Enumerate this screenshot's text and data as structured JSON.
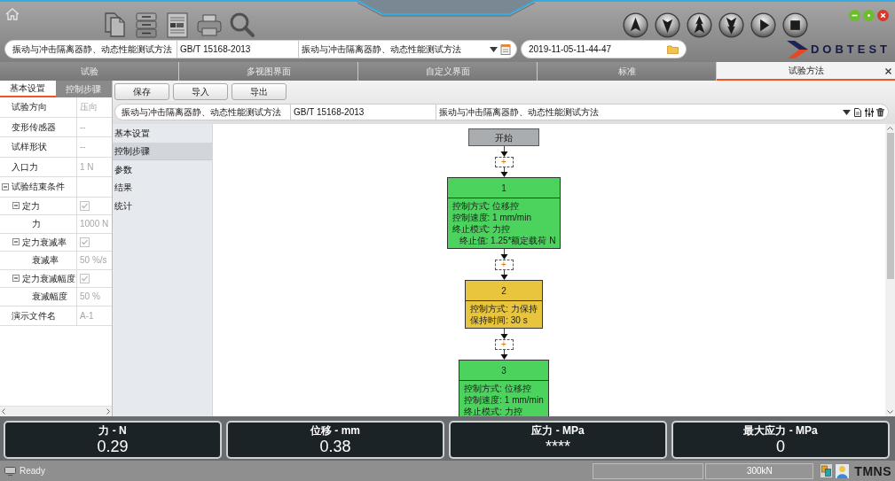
{
  "header": {
    "method_field": {
      "name": "振动与冲击隔离器静、动态性能测试方法",
      "standard": "GB/T 15168-2013",
      "title": "振动与冲击隔离器静、动态性能测试方法"
    },
    "date_field": {
      "value": "2019-11-05-11-44-47"
    },
    "logo": {
      "text": "DOBTEST"
    }
  },
  "tabs": [
    {
      "label": "试验",
      "selected": false
    },
    {
      "label": "多视图界面",
      "selected": false
    },
    {
      "label": "自定义界面",
      "selected": false
    },
    {
      "label": "标准",
      "selected": false
    },
    {
      "label": "试验方法",
      "selected": true
    }
  ],
  "left_panel": {
    "tabs": [
      {
        "label": "基本设置",
        "selected": true
      },
      {
        "label": "控制步骤",
        "selected": false
      }
    ],
    "properties": [
      {
        "kind": "text",
        "label": "试验方向",
        "value": "压向"
      },
      {
        "kind": "text",
        "label": "变形传感器",
        "value": "--"
      },
      {
        "kind": "text",
        "label": "试样形状",
        "value": "--"
      },
      {
        "kind": "text",
        "label": "入口力",
        "value": "1 N"
      },
      {
        "kind": "group",
        "label": "试验结束条件",
        "expanded": true,
        "children": [
          {
            "kind": "check",
            "label": "定力",
            "checked": true,
            "expanded": true,
            "children": [
              {
                "kind": "text",
                "label": "力",
                "value": "1000 N"
              }
            ]
          },
          {
            "kind": "check",
            "label": "定力衰减率",
            "checked": true,
            "expanded": true,
            "children": [
              {
                "kind": "text",
                "label": "衰减率",
                "value": "50 %/s"
              }
            ]
          },
          {
            "kind": "check",
            "label": "定力衰减幅度",
            "checked": true,
            "expanded": true,
            "children": [
              {
                "kind": "text",
                "label": "衰减幅度",
                "value": "50 %"
              }
            ]
          }
        ]
      },
      {
        "kind": "text",
        "label": "演示文件名",
        "value": "A-1"
      }
    ]
  },
  "actions": [
    {
      "label": "保存"
    },
    {
      "label": "导入"
    },
    {
      "label": "导出"
    }
  ],
  "method_bar": {
    "name": "振动与冲击隔离器静、动态性能测试方法",
    "standard": "GB/T 15168-2013",
    "title": "振动与冲击隔离器静、动态性能测试方法"
  },
  "nav": [
    {
      "label": "基本设置",
      "selected": false
    },
    {
      "label": "控制步骤",
      "selected": true
    },
    {
      "label": "参数",
      "selected": false
    },
    {
      "label": "结果",
      "selected": false
    },
    {
      "label": "统计",
      "selected": false
    }
  ],
  "flowchart": {
    "start": "开始",
    "steps": [
      {
        "insert": "+",
        "number": "1",
        "color": "#4cd35e",
        "lines": [
          {
            "text": "控制方式: 位移控"
          },
          {
            "text": "控制速度: 1 mm/min"
          },
          {
            "text": "终止模式: 力控",
            "children": [
              {
                "text": "终止值: 1.25*额定载荷 N"
              }
            ]
          }
        ]
      },
      {
        "insert": "+",
        "number": "2",
        "color": "#e8c53c",
        "lines": [
          {
            "text": "控制方式: 力保持"
          },
          {
            "text": "保持时间: 30 s"
          }
        ]
      },
      {
        "insert": "+",
        "number": "3",
        "color": "#4cd35e",
        "lines": [
          {
            "text": "控制方式: 位移控"
          },
          {
            "text": "控制速度: 1 mm/min"
          },
          {
            "text": "终止模式: 力控"
          }
        ]
      }
    ]
  },
  "readouts": [
    {
      "label": "力 - N",
      "value": "0.29"
    },
    {
      "label": "位移 - mm",
      "value": "0.38"
    },
    {
      "label": "应力 - MPa",
      "value": "****"
    },
    {
      "label": "最大应力 - MPa",
      "value": "0"
    }
  ],
  "status_bar": {
    "message": "Ready",
    "capacity": "300kN",
    "logo": "TMNS"
  }
}
